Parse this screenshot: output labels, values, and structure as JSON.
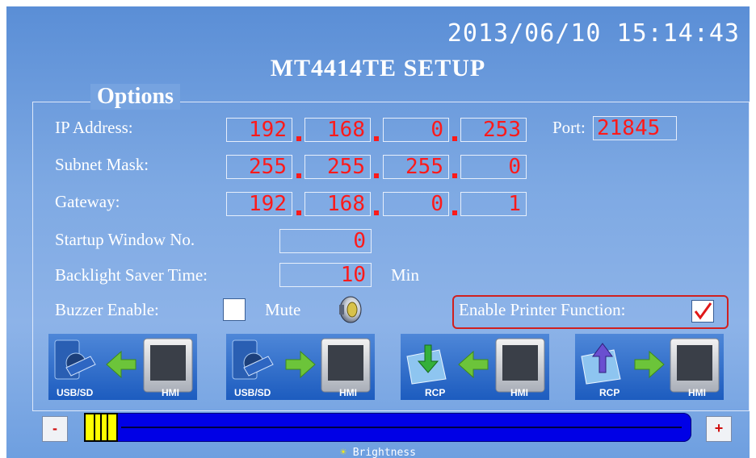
{
  "header": {
    "datetime": "2013/06/10  15:14:43",
    "title": "MT4414TE  SETUP"
  },
  "options": {
    "label": "Options",
    "ip_label": "IP Address:",
    "ip": [
      "192",
      "168",
      "0",
      "253"
    ],
    "port_label": "Port:",
    "port": "21845",
    "subnet_label": "Subnet Mask:",
    "subnet": [
      "255",
      "255",
      "255",
      "0"
    ],
    "gateway_label": "Gateway:",
    "gateway": [
      "192",
      "168",
      "0",
      "1"
    ],
    "startup_label": "Startup Window No.",
    "startup": "0",
    "backlight_label": "Backlight Saver Time:",
    "backlight": "10",
    "backlight_unit": "Min",
    "buzzer_label": "Buzzer Enable:",
    "buzzer_checked": false,
    "mute_label": "Mute",
    "printer_label": "Enable Printer Function:",
    "printer_checked": true
  },
  "transfers": [
    {
      "left": "USB/SD",
      "right": "HMI",
      "arrow": "to-left",
      "source_icon": "usb-sd-icon"
    },
    {
      "left": "USB/SD",
      "right": "HMI",
      "arrow": "to-right",
      "source_icon": "usb-sd-icon"
    },
    {
      "left": "RCP",
      "right": "HMI",
      "arrow": "to-left",
      "source_icon": "rcp-folder-download-icon"
    },
    {
      "left": "RCP",
      "right": "HMI",
      "arrow": "to-right",
      "source_icon": "rcp-folder-upload-icon"
    }
  ],
  "brightness": {
    "minus": "-",
    "plus": "+",
    "label": "Brightness",
    "level": 0.0
  },
  "colors": {
    "field_text": "#ff1a1a",
    "printer_highlight": "#d0201f",
    "slider_track": "#0000e6",
    "slider_thumb": "#ffff00",
    "arrow_green": "#6cc43a"
  }
}
